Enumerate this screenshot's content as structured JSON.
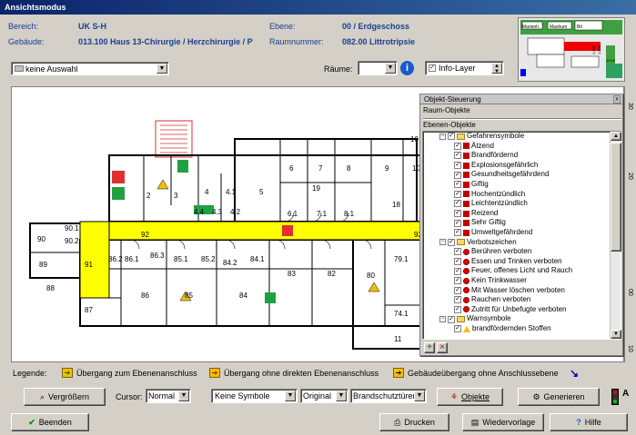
{
  "window": {
    "title": "Ansichtsmodus"
  },
  "info": {
    "bereich_label": "Bereich:",
    "bereich_value": "UK S-H",
    "gebaeude_label": "Gebäude:",
    "gebaeude_value": "013.100 Haus 13-Chirurgie / Herzchirurgie / P",
    "ebene_label": "Ebene:",
    "ebene_value": "00 / Erdgeschoss",
    "raumnummer_label": "Raumnummer:",
    "raumnummer_value": "082.00 Littrotripsie"
  },
  "toolbar": {
    "auswahl_value": "keine Auswahl",
    "raeume_label": "Räume:",
    "raeume_value": "",
    "infolayer_label": "Info-Layer"
  },
  "minimap": {
    "labels": [
      "Marienh.",
      "Mashum",
      "Bit",
      "1.000",
      "1.000",
      "10.05"
    ]
  },
  "rooms": [
    "10",
    "2",
    "3",
    "4",
    "4.1",
    "4.2",
    "4.3",
    "4.4",
    "5",
    "6",
    "7",
    "8",
    "9",
    "10",
    "19",
    "6.1",
    "7.1",
    "8.1",
    "18",
    "90",
    "90.1",
    "90.2",
    "92",
    "92",
    "89",
    "88",
    "91",
    "86.2",
    "86.1",
    "86.3",
    "85.1",
    "85.2",
    "84.2",
    "84.1",
    "83",
    "82",
    "80",
    "79.1",
    "87",
    "86",
    "85",
    "84",
    "74.1",
    "11"
  ],
  "panel": {
    "title": "Objekt-Steuerung",
    "raum_objekte": "Raum-Objekte",
    "ebenen_objekte": "Ebenen-Objekte",
    "groups": [
      {
        "name": "Gefahrensymbole",
        "icon": "square",
        "items": [
          "Ätzend",
          "Brandfördernd",
          "Explosionsgefährlich",
          "Gesundheitsgefährdend",
          "Giftig",
          "Hochentzündlich",
          "Leichtentzündlich",
          "Reizend",
          "Sehr Giftig",
          "Umweltgefährdend"
        ]
      },
      {
        "name": "Verbotszeichen",
        "icon": "circle",
        "items": [
          "Berühren verboten",
          "Essen und Trinken verboten",
          "Feuer, offenes Licht und Rauch",
          "Kein Trinkwasser",
          "Mit Wasser löschen verboten",
          "Rauchen verboten",
          "Zutritt für Unbefugte verboten"
        ]
      },
      {
        "name": "Warnsymbole",
        "icon": "triangle",
        "items": [
          "brandfördernden Stoffen"
        ]
      }
    ]
  },
  "ruler": [
    "30",
    "20",
    "00",
    "10"
  ],
  "legend": {
    "label": "Legende:",
    "items": [
      "Übergang zum Ebenenanschluss",
      "Übergang ohne direkten Ebenenanschluss",
      "Gebäudeübergang ohne Anschlussebene"
    ]
  },
  "controls": {
    "zoom_button": "Vergrößern",
    "cursor_label": "Cursor:",
    "cursor_value": "Normal",
    "symbole_value": "Keine Symbole",
    "original_value": "Original",
    "brandschutz_value": "Brandschutztüren",
    "objekte_button": "Objekte",
    "generieren_button": "Generieren"
  },
  "footer": {
    "beenden_button": "Beenden",
    "drucken_button": "Drucken",
    "wiedervorlage_button": "Wiedervorlage",
    "hilfe_button": "Hilfe"
  },
  "colors": {
    "corridor": "#ffff00",
    "selected_room": "#ffff00",
    "panel_header": "#d4d0c8",
    "title_bar": "#0a246a"
  }
}
